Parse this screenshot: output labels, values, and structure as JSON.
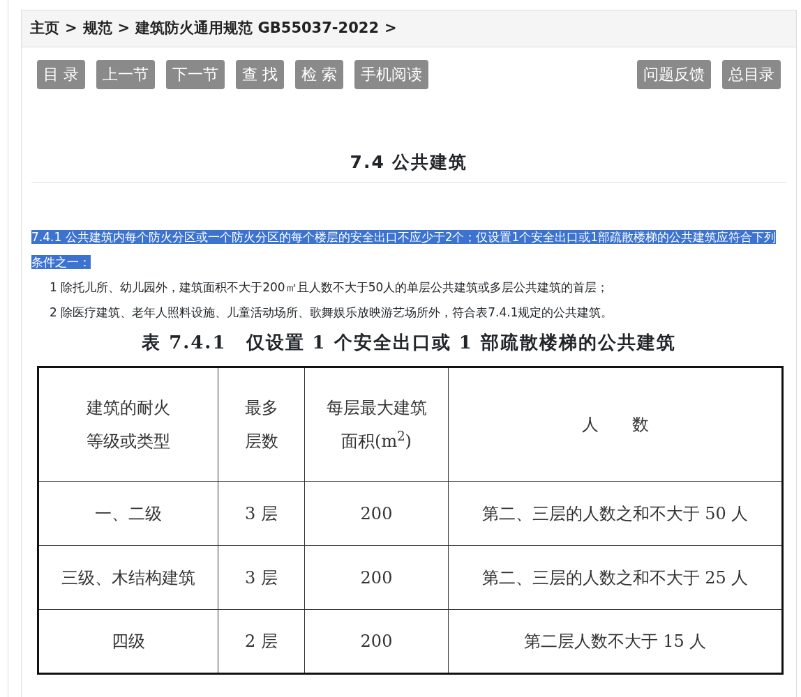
{
  "breadcrumb": [
    "主页",
    ">",
    "规范",
    ">",
    "建筑防火通用规范 GB55037-2022",
    ">"
  ],
  "toolbar_left": [
    "目 录",
    "上一节",
    "下一节",
    "查 找",
    "检 索",
    "手机阅读"
  ],
  "toolbar_right": [
    "问题反馈",
    "总目录"
  ],
  "section_title": "7.4 公共建筑",
  "paragraphs": [
    {
      "text": "7.4.1 公共建筑内每个防火分区或一个防火分区的每个楼层的安全出口不应少于2个；仅设置1个安全出口或1部疏散楼梯的公共建筑应符合下列条件之一：",
      "highlighted": true
    },
    {
      "text": "1 除托儿所、幼儿园外，建筑面积不大于200㎡且人数不大于50人的单层公共建筑或多层公共建筑的首层；",
      "highlighted": false
    },
    {
      "text": "2 除医疗建筑、老年人照料设施、儿童活动场所、歌舞娱乐放映游艺场所外，符合表7.4.1规定的公共建筑。",
      "highlighted": false
    }
  ],
  "table": {
    "caption": "表 7.4.1　仅设置 1 个安全出口或 1 部疏散楼梯的公共建筑",
    "columns": [
      "建筑的耐火等级或类型",
      "最多层数",
      "每层最大建筑面积(m$^{2}$)",
      "人　　数"
    ],
    "rows": [
      [
        "一、二级",
        "3 层",
        "200",
        "第二、三层的人数之和不大于 50 人"
      ],
      [
        "三级、木结构建筑",
        "3 层",
        "200",
        "第二、三层的人数之和不大于 25 人"
      ],
      [
        "四级",
        "2 层",
        "200",
        "第二层人数不大于 15 人"
      ]
    ]
  }
}
